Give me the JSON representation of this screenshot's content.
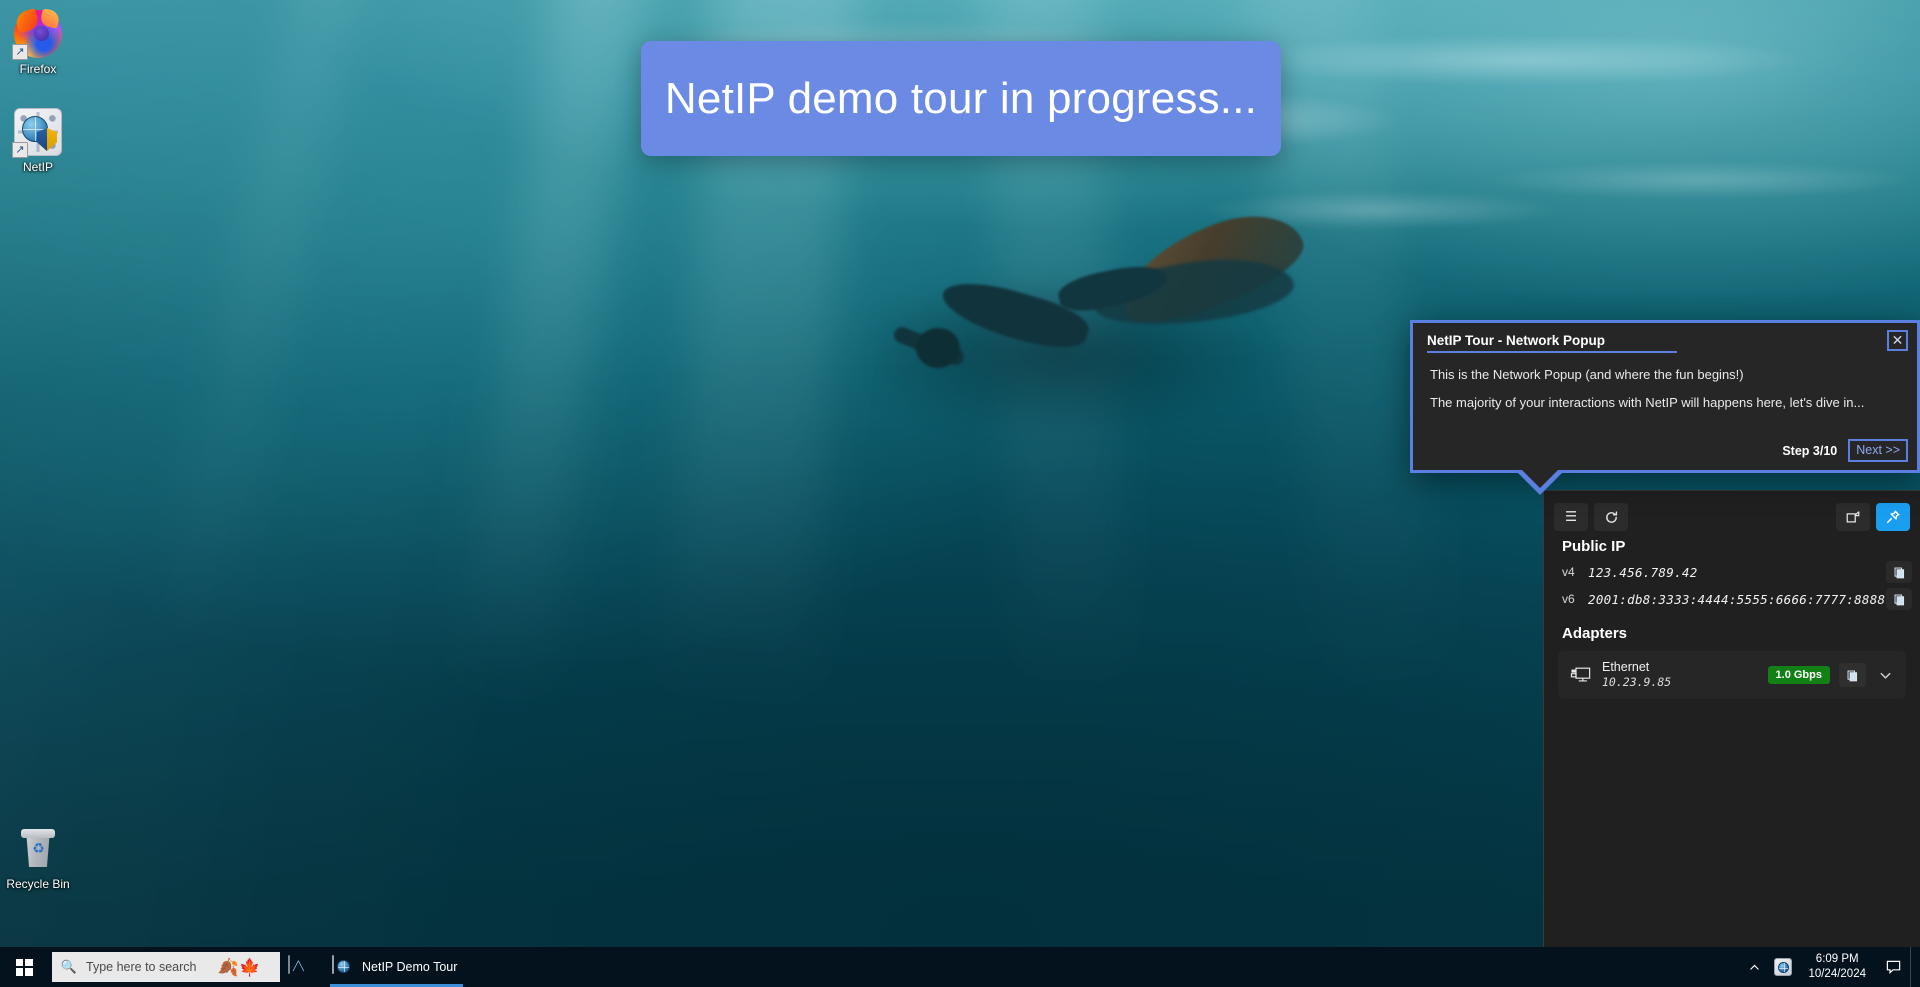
{
  "desktop": {
    "icons": [
      {
        "label": "Firefox",
        "icon": "firefox-icon",
        "shortcut": true
      },
      {
        "label": "NetIP",
        "icon": "netip-app-icon",
        "shortcut": true
      },
      {
        "label": "Recycle Bin",
        "icon": "recycle-bin-icon",
        "shortcut": false
      }
    ]
  },
  "banner": {
    "text": "NetIP demo tour in progress...",
    "background_color": "#6b8ae4",
    "text_color": "#ffffff"
  },
  "tour_popup": {
    "title": "NetIP Tour - Network Popup",
    "close_label": "✕",
    "line1": "This is the Network Popup (and where the fun begins!)",
    "line2": "The majority of your interactions with NetIP will happens here, let's dive in...",
    "step_label": "Step 3/10",
    "next_label": "Next >>",
    "accent_color": "#5b7fe0",
    "background_color": "#262626"
  },
  "netip_panel": {
    "toolbar": {
      "menu_label": "☰",
      "menu_icon": "hamburger-menu-icon",
      "refresh_label": "↻",
      "refresh_icon": "refresh-icon",
      "dock_icon": "dock-corner-icon",
      "pin_icon": "pin-icon",
      "pin_active": true,
      "accent_color": "#1a9ff0"
    },
    "public_ip": {
      "title": "Public IP",
      "entries": [
        {
          "version": "v4",
          "value": "123.456.789.42",
          "copy_icon": "copy-icon"
        },
        {
          "version": "v6",
          "value": "2001:db8:3333:4444:5555:6666:7777:8888",
          "copy_icon": "copy-icon"
        }
      ]
    },
    "adapters": {
      "title": "Adapters",
      "items": [
        {
          "name": "Ethernet",
          "ip": "10.23.9.85",
          "speed": "1.0 Gbps",
          "speed_color": "#128014",
          "icon": "ethernet-adapter-icon",
          "copy_icon": "copy-icon",
          "expand_icon": "chevron-down-icon"
        }
      ]
    }
  },
  "taskbar": {
    "start_label": "Start",
    "search": {
      "placeholder": "Type here to search",
      "icon": "search-icon",
      "decoration_icon": "autumn-leaves-icon",
      "decoration_glyph": "🍂"
    },
    "tasks": [
      {
        "label": "",
        "icon": "performance-monitor-icon",
        "active": false
      },
      {
        "label": "NetIP Demo Tour",
        "icon": "netip-app-icon",
        "active": true
      }
    ],
    "tray": {
      "overflow_icon": "chevron-up-icon",
      "apps": [
        {
          "icon": "netip-tray-icon"
        }
      ],
      "time": "6:09 PM",
      "date": "10/24/2024",
      "notification_icon": "notification-bell-icon"
    }
  }
}
